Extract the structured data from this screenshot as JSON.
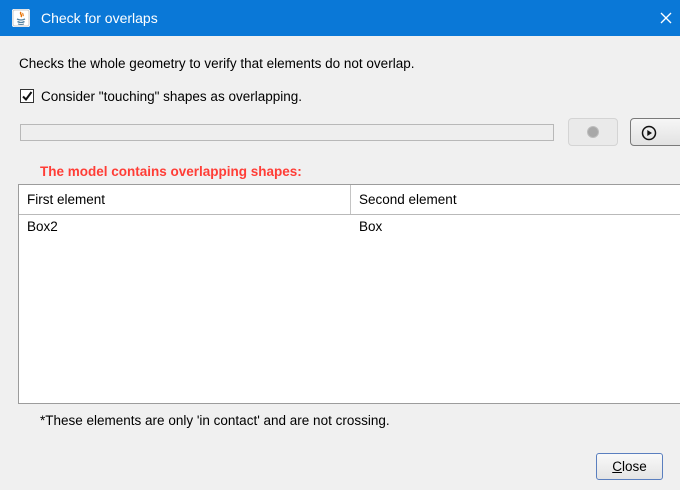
{
  "window": {
    "title": "Check for overlaps",
    "close_icon": "close-x-icon"
  },
  "dialog": {
    "description": "Checks the whole geometry to verify that elements do not overlap.",
    "touching_checkbox": {
      "label": "Consider \"touching\" shapes as overlapping.",
      "checked": true
    },
    "progress_percent": 0,
    "stop_button_icon": "stop-icon",
    "run_button_icon": "play-icon",
    "overlap_heading": "The model contains overlapping shapes:",
    "overlap_heading_color": "#ff3d36",
    "table": {
      "columns": [
        "First element",
        "Second element"
      ],
      "rows": [
        [
          "Box2",
          "Box"
        ]
      ]
    },
    "footnote": "*These elements are only 'in contact' and are not crossing.",
    "close_button": {
      "mnemonic": "C",
      "rest": "lose"
    }
  },
  "colors": {
    "titlebar": "#0a78d7",
    "accent": "#3a89d8"
  }
}
